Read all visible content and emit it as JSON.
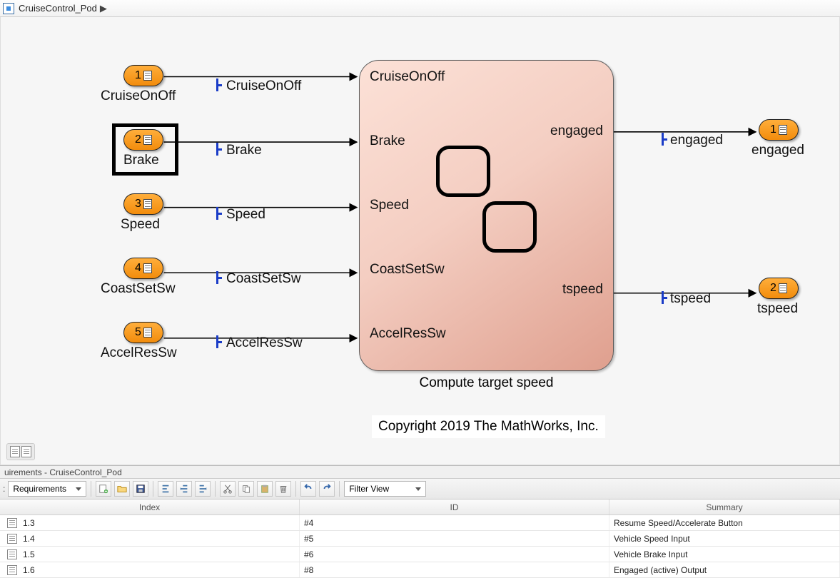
{
  "breadcrumb": {
    "model": "CruiseControl_Pod"
  },
  "inputs": [
    {
      "num": "1",
      "name": "CruiseOnOff",
      "signal": "CruiseOnOff"
    },
    {
      "num": "2",
      "name": "Brake",
      "signal": "Brake",
      "selected": true
    },
    {
      "num": "3",
      "name": "Speed",
      "signal": "Speed"
    },
    {
      "num": "4",
      "name": "CoastSetSw",
      "signal": "CoastSetSw"
    },
    {
      "num": "5",
      "name": "AccelResSw",
      "signal": "AccelResSw"
    }
  ],
  "outputs": [
    {
      "num": "1",
      "name": "engaged",
      "signal": "engaged"
    },
    {
      "num": "2",
      "name": "tspeed",
      "signal": "tspeed"
    }
  ],
  "block": {
    "title": "Compute target speed",
    "in_ports": [
      "CruiseOnOff",
      "Brake",
      "Speed",
      "CoastSetSw",
      "AccelResSw"
    ],
    "out_ports": [
      "engaged",
      "tspeed"
    ]
  },
  "copyright": "Copyright 2019 The MathWorks, Inc.",
  "req_panel": {
    "title": "uirements - CruiseControl_Pod",
    "view_label": "Requirements",
    "filter_label": "Filter View",
    "columns": {
      "index": "Index",
      "id": "ID",
      "summary": "Summary"
    },
    "rows": [
      {
        "index": "1.3",
        "id": "#4",
        "summary": "Resume Speed/Accelerate Button"
      },
      {
        "index": "1.4",
        "id": "#5",
        "summary": "Vehicle Speed Input"
      },
      {
        "index": "1.5",
        "id": "#6",
        "summary": "Vehicle Brake Input"
      },
      {
        "index": "1.6",
        "id": "#8",
        "summary": "Engaged (active) Output"
      }
    ]
  }
}
